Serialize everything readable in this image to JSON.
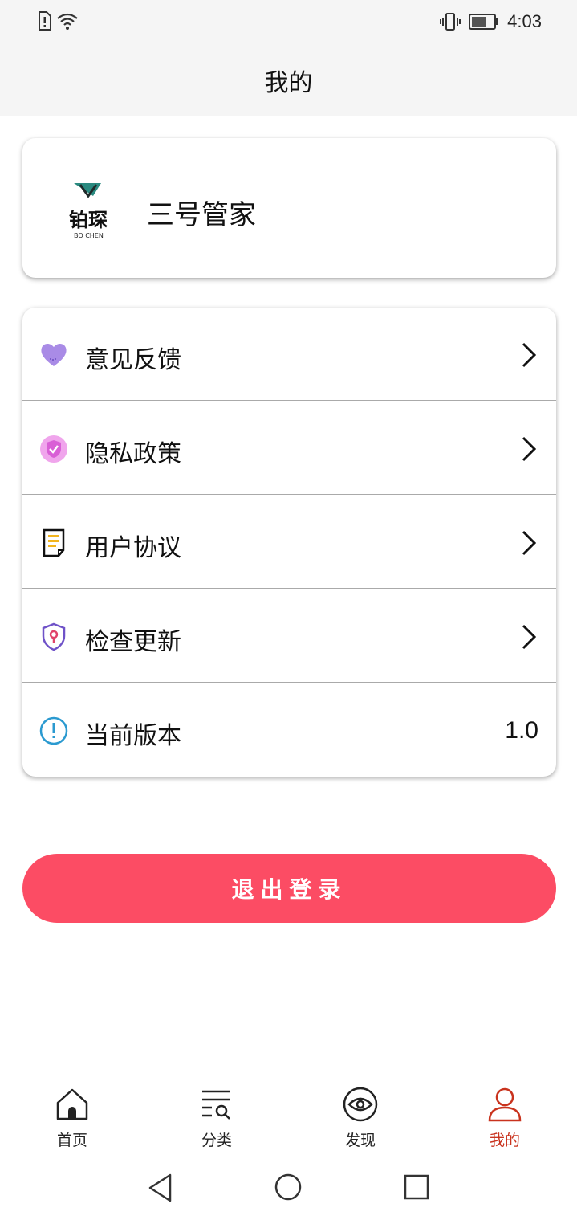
{
  "status_bar": {
    "time": "4:03"
  },
  "header": {
    "title": "我的"
  },
  "profile": {
    "logo_text": "铂琛",
    "logo_subtext": "BO CHEN",
    "name": "三号管家"
  },
  "menu": [
    {
      "label": "意见反馈",
      "icon": "heart-icon"
    },
    {
      "label": "隐私政策",
      "icon": "shield-check-icon"
    },
    {
      "label": "用户协议",
      "icon": "document-icon"
    },
    {
      "label": "检查更新",
      "icon": "shield-pin-icon"
    },
    {
      "label": "当前版本",
      "icon": "info-icon",
      "value": "1.0"
    }
  ],
  "logout": {
    "label": "退出登录"
  },
  "tabs": [
    {
      "label": "首页",
      "icon": "home-icon"
    },
    {
      "label": "分类",
      "icon": "list-search-icon"
    },
    {
      "label": "发现",
      "icon": "eye-icon"
    },
    {
      "label": "我的",
      "icon": "person-icon",
      "active": true
    }
  ],
  "colors": {
    "accent": "#fc4c64",
    "tab_active": "#c9331e",
    "header_bg": "#f5f5f5"
  }
}
